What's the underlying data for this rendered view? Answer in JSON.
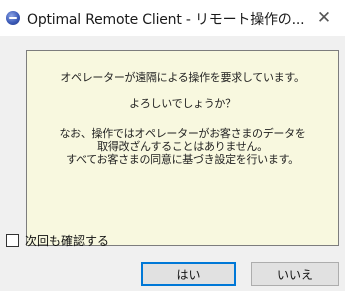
{
  "window": {
    "title": "Optimal Remote Client - リモート操作の...",
    "close_glyph": "✕",
    "app_icon": "app-globe-icon"
  },
  "message": {
    "line1": "オペレーターが遠隔による操作を要求しています。",
    "line2": "よろしいでしょうか？",
    "line3": "なお、操作ではオペレーターがお客さまのデータを",
    "line4": "取得改ざんすることはありません。",
    "line5": "すべてお客さまの同意に基づき設定を行います。"
  },
  "options": {
    "dont_ask_again_label": "次回も確認する",
    "dont_ask_again_checked": false
  },
  "buttons": {
    "yes_label": "はい",
    "no_label": "いいえ"
  },
  "colors": {
    "message_background": "#f8f8df",
    "default_button_border": "#0078d7"
  }
}
